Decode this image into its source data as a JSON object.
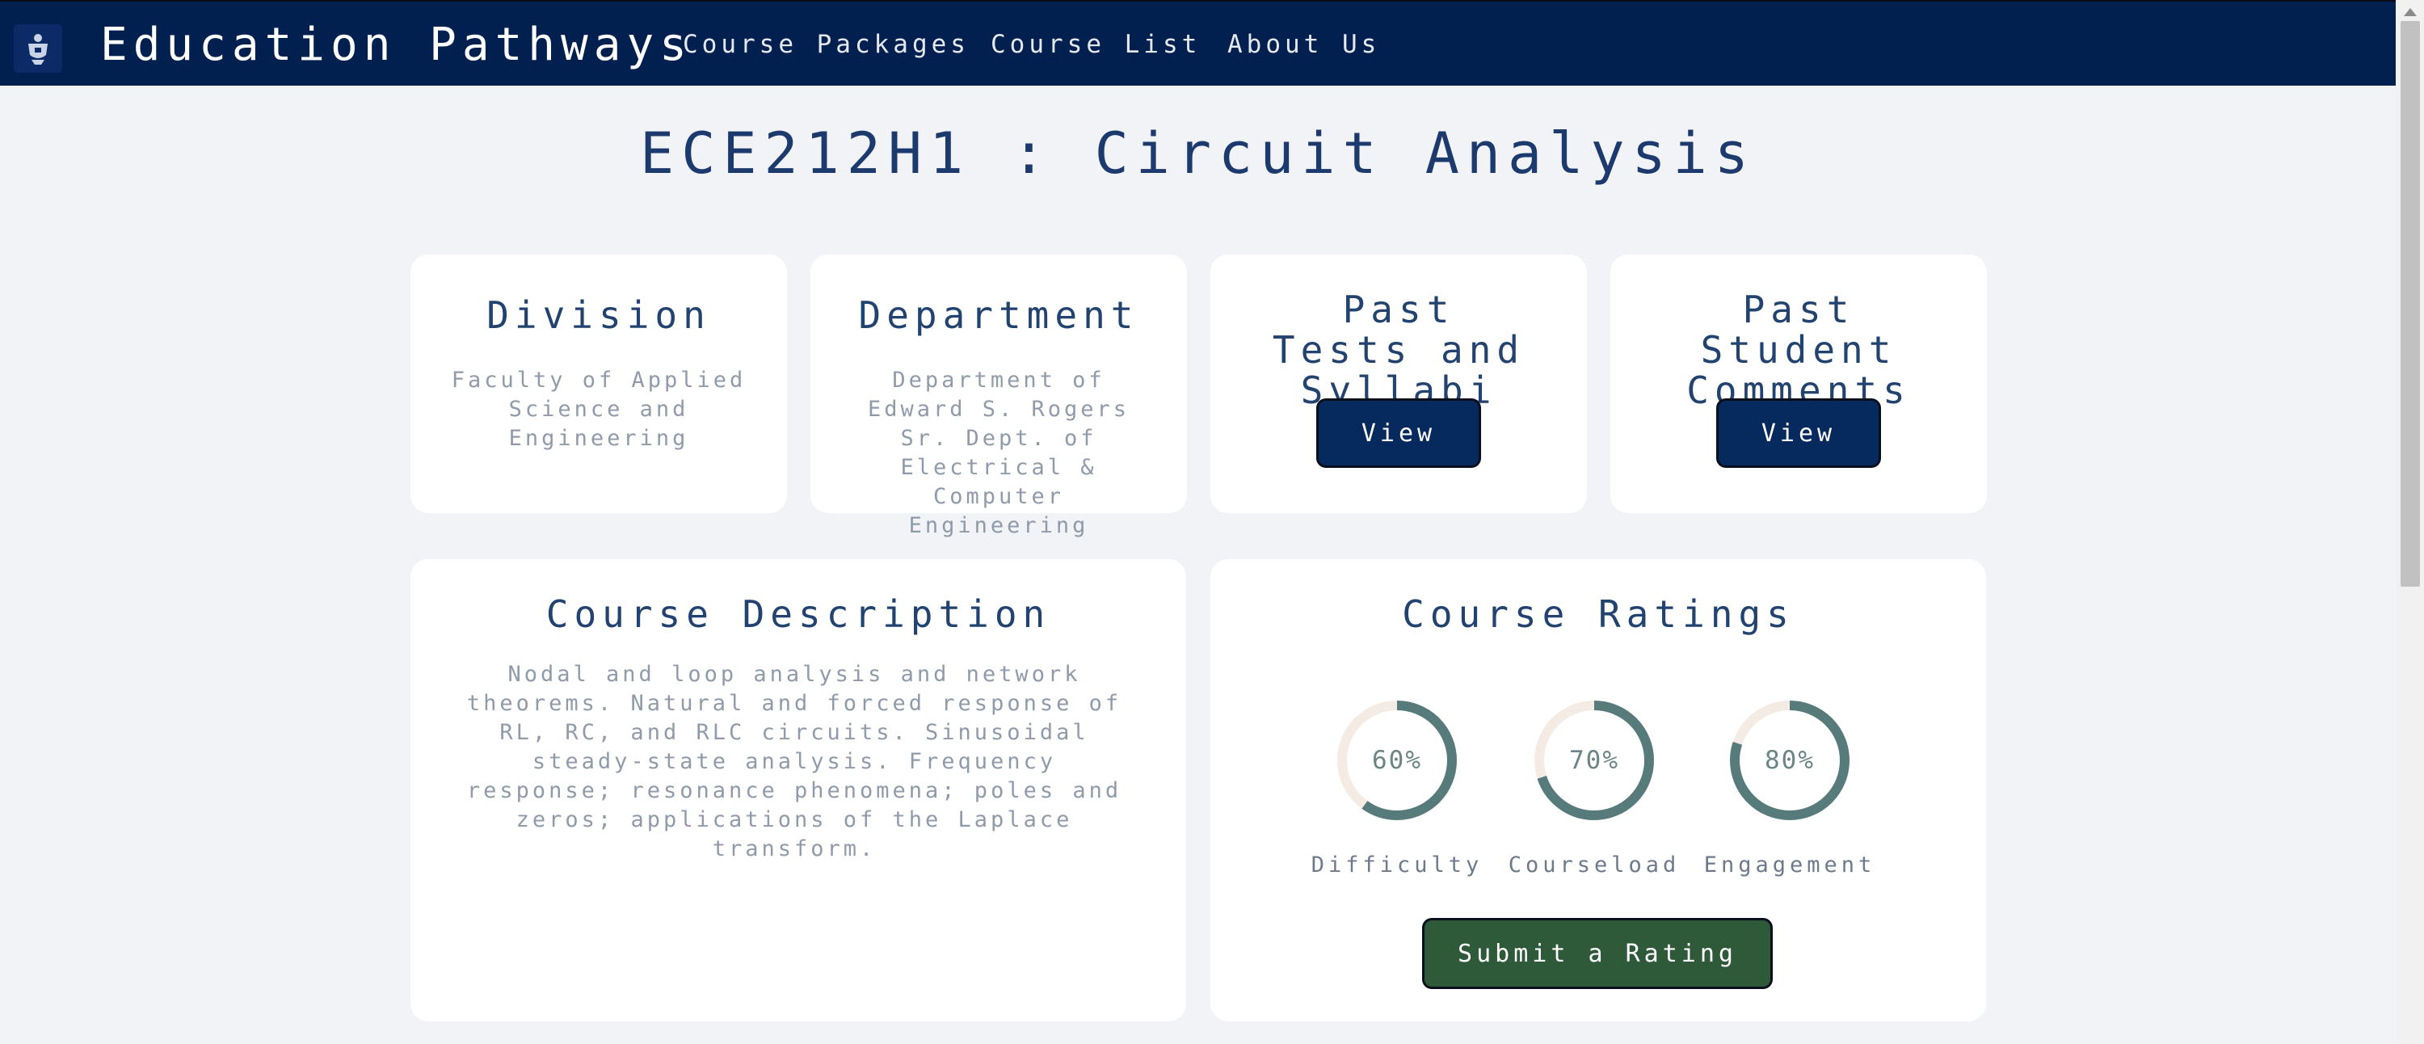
{
  "navbar": {
    "logo_icon": "university-crest-icon",
    "site_title": "Education Pathways",
    "links": [
      "Course Packages",
      "Course List",
      "About Us"
    ]
  },
  "course": {
    "title": "ECE212H1 : Circuit Analysis"
  },
  "division": {
    "heading": "Division",
    "value": "Faculty of Applied Science and Engineering"
  },
  "department": {
    "heading": "Department",
    "value": "Department of Edward S. Rogers Sr. Dept. of Electrical & Computer Engineering"
  },
  "past_tests": {
    "heading": "Past Tests and Syllabi",
    "button_label": "View"
  },
  "past_comments": {
    "heading": "Past Student Comments",
    "button_label": "View"
  },
  "description": {
    "heading": "Course Description",
    "text": "Nodal and loop analysis and network theorems. Natural and forced response of RL, RC, and RLC circuits. Sinusoidal steady-state analysis. Frequency response; resonance phenomena; poles and zeros; applications of the Laplace transform."
  },
  "ratings": {
    "heading": "Course Ratings",
    "items": [
      {
        "label": "Difficulty",
        "percent": 60,
        "display": "60%"
      },
      {
        "label": "Courseload",
        "percent": 70,
        "display": "70%"
      },
      {
        "label": "Engagement",
        "percent": 80,
        "display": "80%"
      }
    ],
    "submit_label": "Submit a Rating"
  },
  "colors": {
    "nav_bg": "#02204f",
    "page_bg": "#f2f3f7",
    "view_button": "#072a5e",
    "submit_button": "#2e5a3a",
    "ring_fill": "#577b7b",
    "ring_track": "#f3ebe4"
  }
}
